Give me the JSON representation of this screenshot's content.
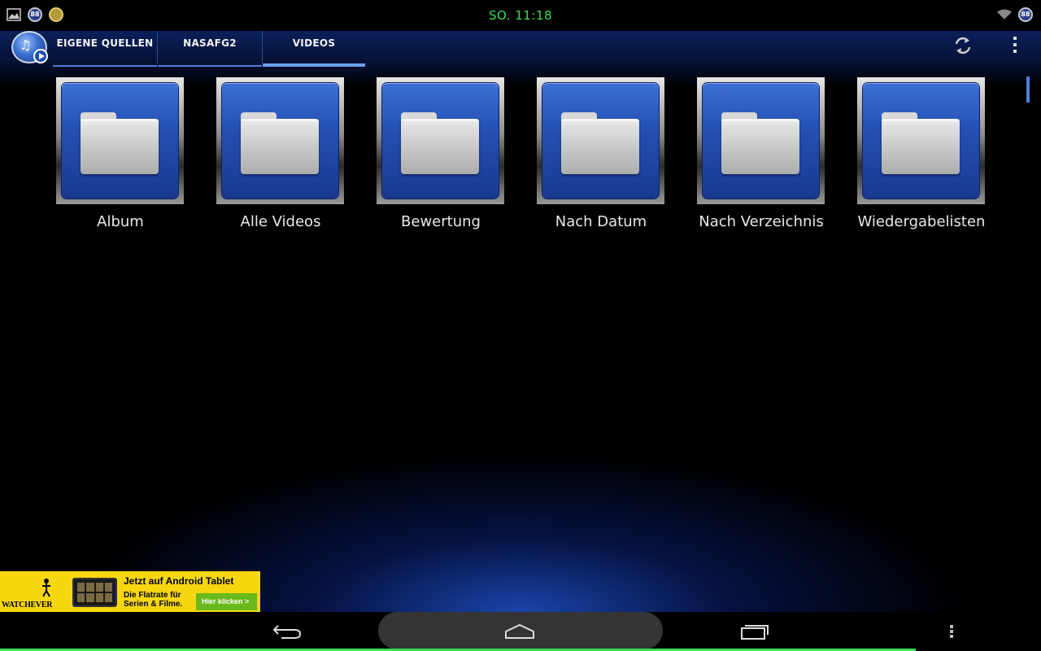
{
  "status_bar": {
    "clock": "SO. 11:18",
    "left_icons": [
      "image-icon",
      "badge-88-icon",
      "gold-app-icon"
    ],
    "left_badge_text": "88",
    "right_badge_text": "88",
    "right_icons": [
      "wifi-icon",
      "battery-badge-icon"
    ]
  },
  "action_bar": {
    "app_icon": "media-app-logo",
    "tabs": [
      {
        "label": "EIGENE QUELLEN",
        "active": false
      },
      {
        "label": "NASAFG2",
        "active": false
      },
      {
        "label": "VIDEOS",
        "active": true
      }
    ],
    "refresh_icon": "refresh-icon",
    "overflow_icon": "overflow-menu-icon"
  },
  "folders": [
    {
      "label": "Album",
      "icon": "folder-icon"
    },
    {
      "label": "Alle Videos",
      "icon": "folder-icon"
    },
    {
      "label": "Bewertung",
      "icon": "folder-icon"
    },
    {
      "label": "Nach Datum",
      "icon": "folder-icon"
    },
    {
      "label": "Nach Verzeichnis",
      "icon": "folder-icon"
    },
    {
      "label": "Wiedergabelisten",
      "icon": "folder-icon"
    }
  ],
  "ad": {
    "brand": "WATCHEVER",
    "title": "Jetzt auf Android Tablet",
    "subtitle_line1": "Die Flatrate für",
    "subtitle_line2": "Serien & Filme.",
    "cta": "Hier klicken >",
    "background_color": "#f6d70f",
    "cta_color": "#6ab91c"
  },
  "nav_bar": {
    "buttons": [
      "back-icon",
      "home-icon",
      "recent-apps-icon",
      "menu-icon"
    ]
  },
  "colors": {
    "accent": "#4a7fd6",
    "clock": "#33e055"
  }
}
